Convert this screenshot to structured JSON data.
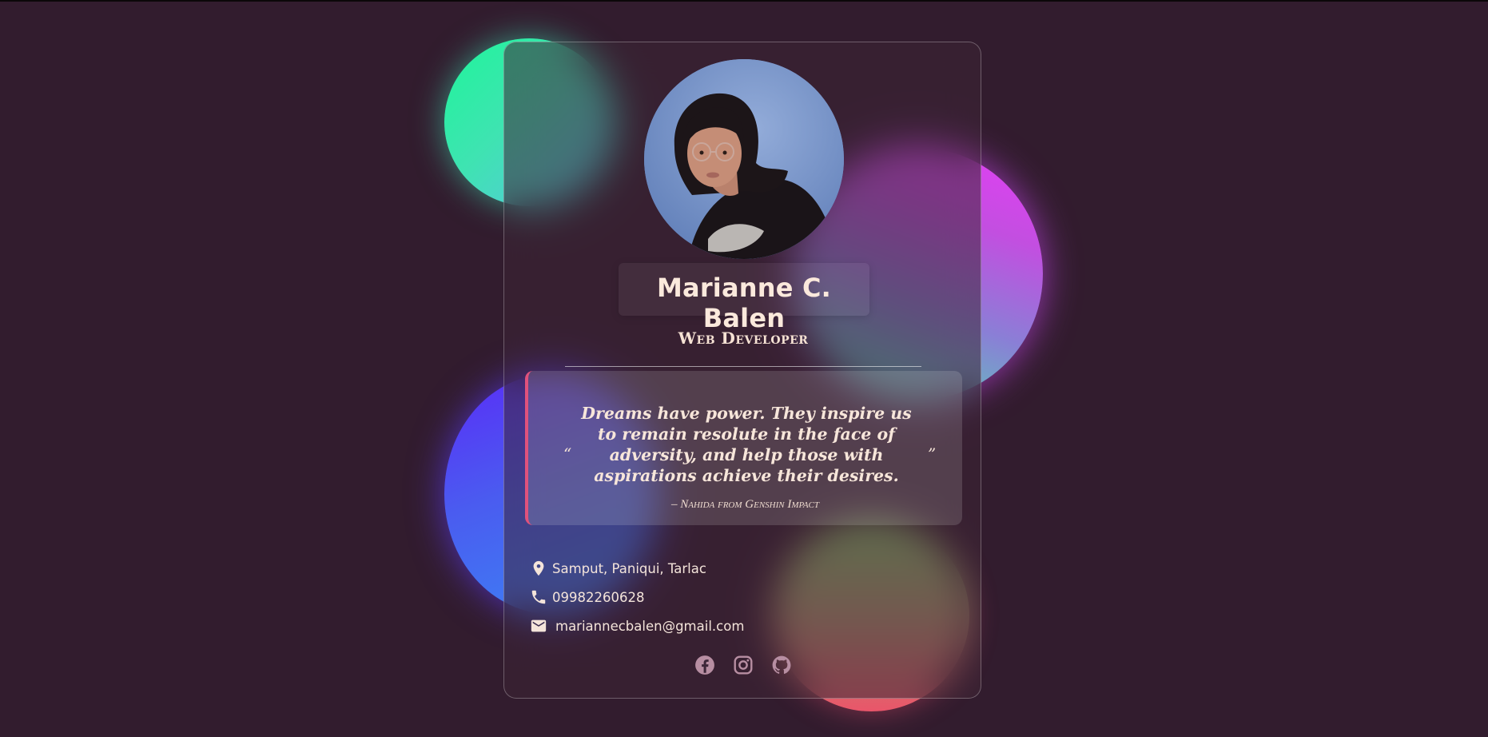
{
  "profile": {
    "name": "Marianne C. Balen",
    "role": "Web Developer",
    "avatar_alt": "Marianne C. Balen"
  },
  "quote": {
    "open_mark": "“",
    "close_mark": "”",
    "text": "Dreams have power. They inspire us to remain resolute in the face of adversity, and help those with aspirations achieve their desires.",
    "author": "– Nahida from Genshin Impact"
  },
  "contact": {
    "location": "Samput, Paniqui, Tarlac",
    "phone": "09982260628",
    "email": "mariannecbalen@gmail.com"
  },
  "socials": [
    {
      "icon": "facebook-icon"
    },
    {
      "icon": "instagram-icon"
    },
    {
      "icon": "github-icon"
    }
  ],
  "colors": {
    "background": "#321c2e",
    "text": "#f7e6da",
    "quote_accent": "#e0527c",
    "blob_teal": "#1ff59a",
    "blob_magenta": "#e63df6",
    "blob_blue": "#5a2cf7",
    "blob_sunset": "#e9556a"
  }
}
